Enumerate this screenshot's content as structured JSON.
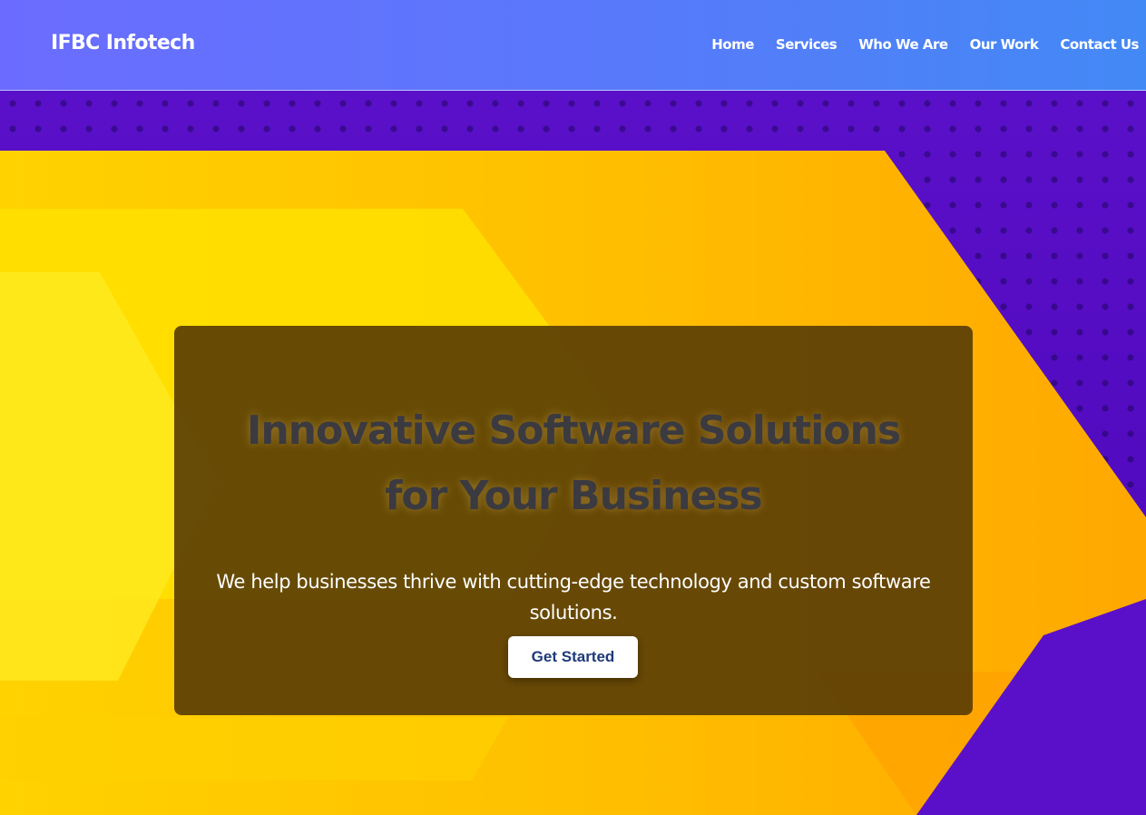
{
  "header": {
    "logo": "IFBC Infotech",
    "nav": [
      "Home",
      "Services",
      "Who We Are",
      "Our Work",
      "Contact Us"
    ]
  },
  "hero": {
    "headline_line1": "Innovative Software Solutions",
    "headline_line2": "for Your Business",
    "subtitle": "We help businesses thrive with cutting-edge technology and custom software solutions.",
    "cta_label": "Get Started"
  },
  "colors": {
    "header_start": "#6b6cff",
    "header_end": "#4389f5",
    "hero_purple": "#4b06b8",
    "hero_yellow": "#ffd400",
    "hero_orange": "#ffa500",
    "cta_text": "#1e3a7a"
  }
}
